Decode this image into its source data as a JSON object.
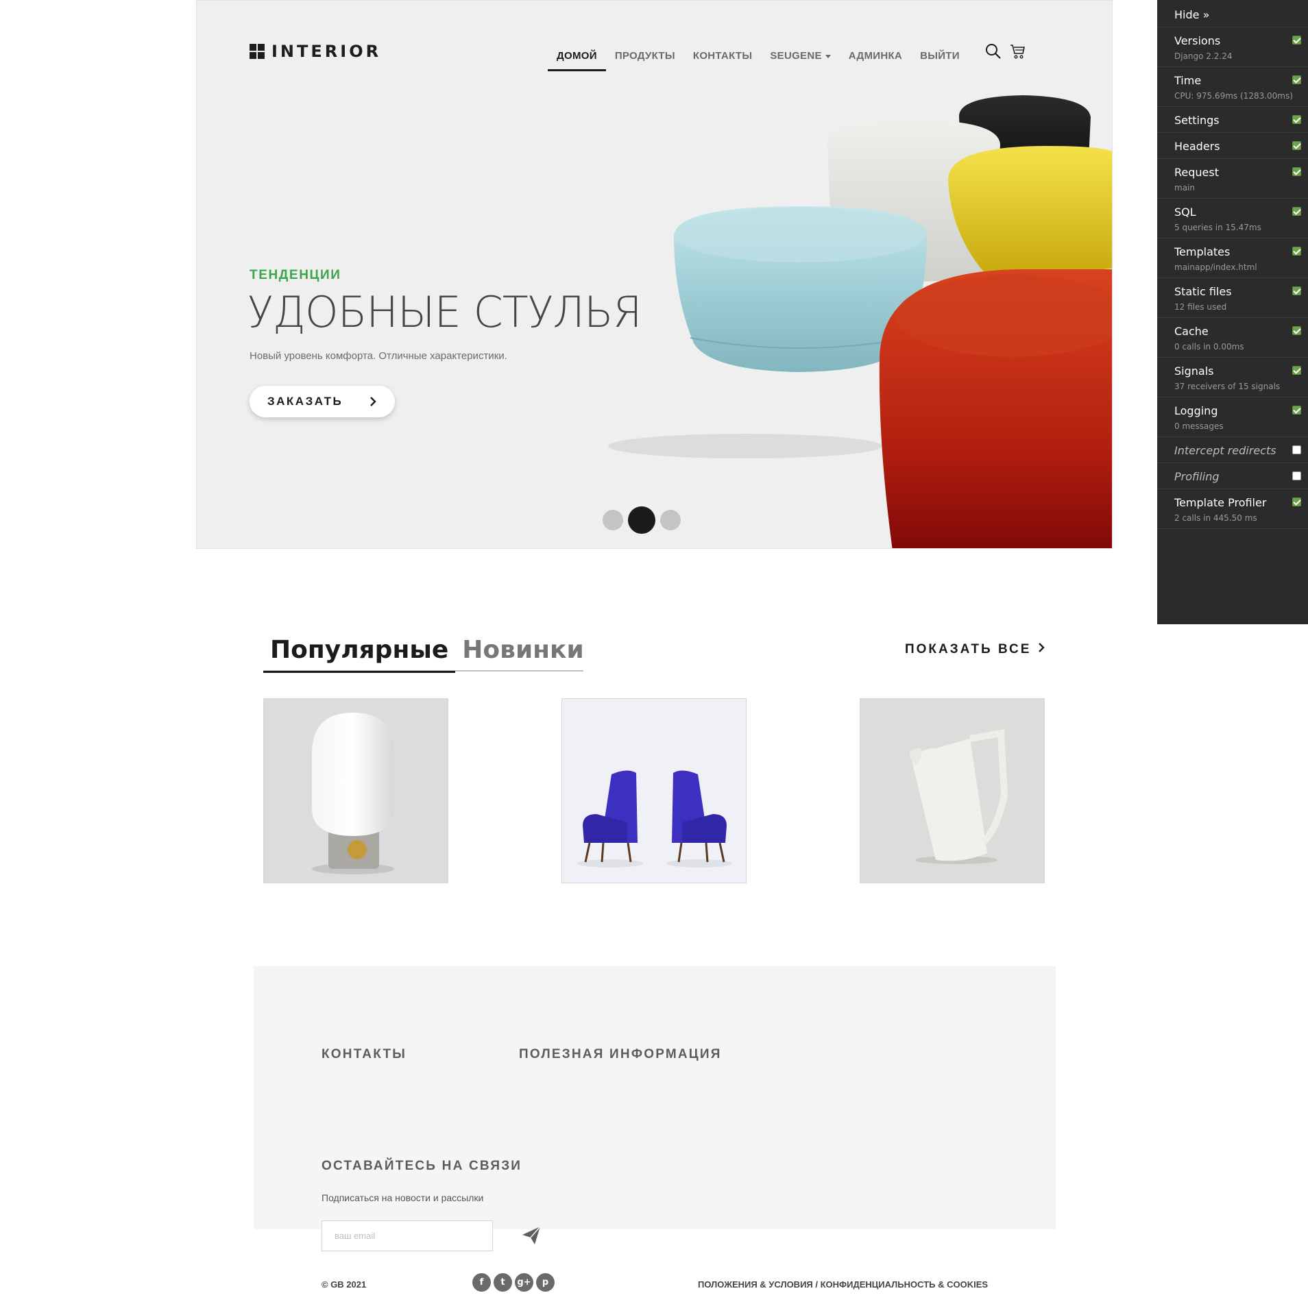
{
  "header": {
    "logo_text": "INTERIOR",
    "nav": [
      {
        "label": "ДОМОЙ",
        "active": true
      },
      {
        "label": "ПРОДУКТЫ"
      },
      {
        "label": "КОНТАКТЫ"
      },
      {
        "label": "SEUGENE",
        "dropdown": true
      },
      {
        "label": "АДМИНКА"
      },
      {
        "label": "ВЫЙТИ"
      }
    ],
    "icons": [
      "search-icon",
      "cart-icon"
    ]
  },
  "hero": {
    "tagline": "ТЕНДЕНЦИИ",
    "headline": "УДОБНЫЕ СТУЛЬЯ",
    "subtext": "Новый уровень комфорта. Отличные характеристики.",
    "cta_label": "ЗАКАЗАТЬ",
    "slides": 3,
    "active_slide": 2,
    "accent_color": "#3aa54a"
  },
  "products": {
    "tabs": [
      "Популярные",
      "Новинки"
    ],
    "active_tab": "Популярные",
    "show_all": "ПОКАЗАТЬ ВСЕ",
    "items": [
      "lamp",
      "blue-armchairs",
      "white-jug"
    ]
  },
  "footer": {
    "contacts_heading": "КОНТАКТЫ",
    "info_heading": "ПОЛЕЗНАЯ ИНФОРМАЦИЯ",
    "stay_heading": "ОСТАВАЙТЕСЬ НА СВЯЗИ",
    "subscribe_text": "Подписаться на новости и рассылки",
    "email_placeholder": "ваш email",
    "copyright": "© GB 2021",
    "socials": [
      "f",
      "t",
      "g+",
      "p"
    ],
    "legal": "ПОЛОЖЕНИЯ & УСЛОВИЯ / КОНФИДЕНЦИАЛЬНОСТЬ & COOKIES"
  },
  "debug_toolbar": {
    "hide_label": "Hide »",
    "items": [
      {
        "title": "Versions",
        "sub": "Django 2.2.24",
        "checked": true
      },
      {
        "title": "Time",
        "sub": "CPU: 975.69ms (1283.00ms)",
        "checked": true
      },
      {
        "title": "Settings",
        "sub": "",
        "checked": true
      },
      {
        "title": "Headers",
        "sub": "",
        "checked": true
      },
      {
        "title": "Request",
        "sub": "main",
        "checked": true
      },
      {
        "title": "SQL",
        "sub": "5 queries in 15.47ms",
        "checked": true
      },
      {
        "title": "Templates",
        "sub": "mainapp/index.html",
        "checked": true
      },
      {
        "title": "Static files",
        "sub": "12 files used",
        "checked": true
      },
      {
        "title": "Cache",
        "sub": "0 calls in 0.00ms",
        "checked": true
      },
      {
        "title": "Signals",
        "sub": "37 receivers of 15 signals",
        "checked": true
      },
      {
        "title": "Logging",
        "sub": "0 messages",
        "checked": true
      },
      {
        "title": "Intercept redirects",
        "sub": "",
        "checked": false
      },
      {
        "title": "Profiling",
        "sub": "",
        "checked": false
      },
      {
        "title": "Template Profiler",
        "sub": "2 calls in 445.50 ms",
        "checked": true
      }
    ]
  }
}
